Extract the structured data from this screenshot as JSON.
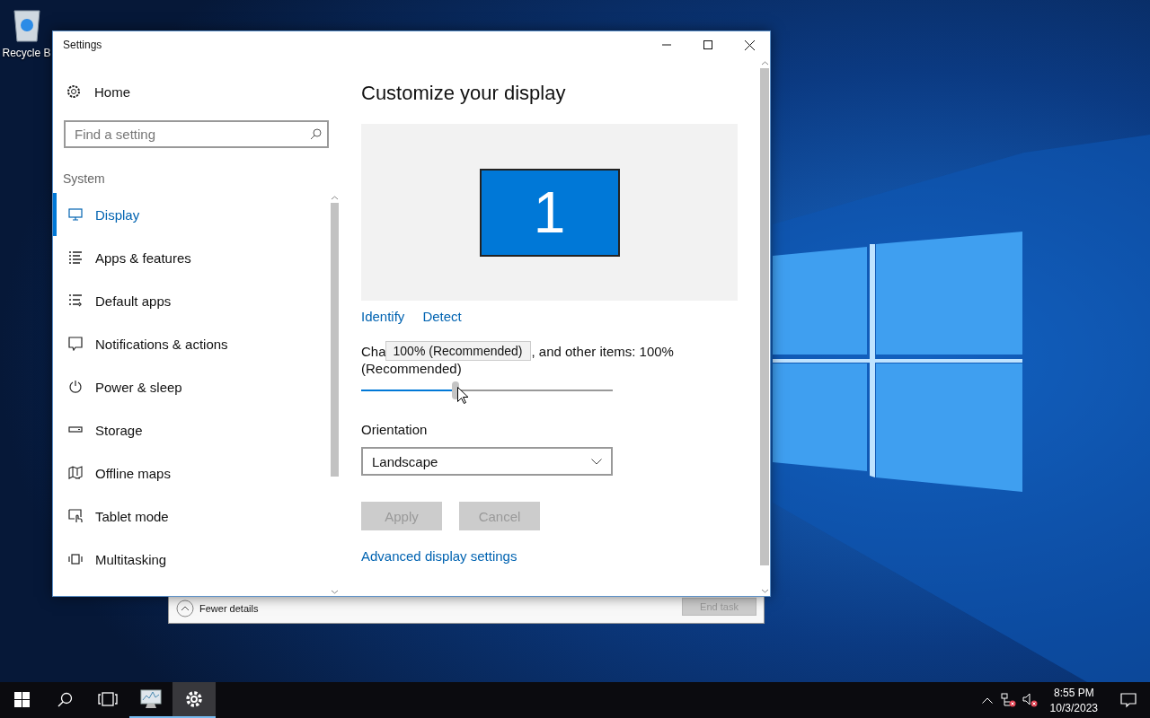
{
  "desktop": {
    "icons": [
      {
        "label": "Recycle B"
      }
    ]
  },
  "task_manager": {
    "details_toggle": "Fewer details",
    "end_task": {
      "label": "End task",
      "disabled": true
    }
  },
  "settings": {
    "title": "Settings",
    "home": "Home",
    "search": {
      "placeholder": "Find a setting"
    },
    "section": "System",
    "nav": [
      {
        "label": "Display",
        "selected": true
      },
      {
        "label": "Apps & features",
        "selected": false
      },
      {
        "label": "Default apps",
        "selected": false
      },
      {
        "label": "Notifications & actions",
        "selected": false
      },
      {
        "label": "Power & sleep",
        "selected": false
      },
      {
        "label": "Storage",
        "selected": false
      },
      {
        "label": "Offline maps",
        "selected": false
      },
      {
        "label": "Tablet mode",
        "selected": false
      },
      {
        "label": "Multitasking",
        "selected": false
      }
    ],
    "heading": "Customize your display",
    "monitor": {
      "number": "1"
    },
    "links": [
      "Identify",
      "Detect"
    ],
    "scale": {
      "label_start": "Cha",
      "label_end": ", and other items: 100%",
      "label_line_2": "(Recommended)",
      "tooltip": "100% (Recommended)",
      "level": 0.375
    },
    "orientation": {
      "label": "Orientation",
      "value": "Landscape"
    },
    "buttons": [
      {
        "label": "Apply",
        "disabled": true
      },
      {
        "label": "Cancel",
        "disabled": true
      }
    ],
    "advanced_link": "Advanced display settings"
  },
  "taskbar": {
    "apps": [
      {
        "selected": false
      },
      {
        "selected": true
      }
    ],
    "clock": {
      "time": "8:55 PM",
      "date": "10/3/2023"
    }
  }
}
